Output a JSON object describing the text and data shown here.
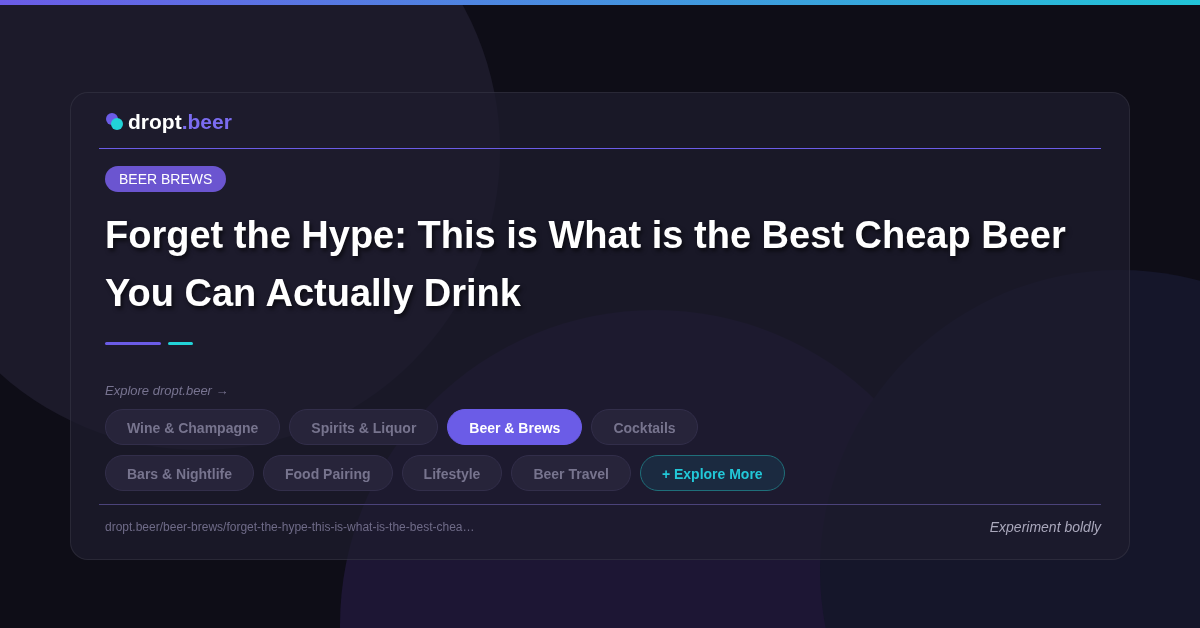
{
  "brand": {
    "name": "dropt",
    "suffix": ".beer"
  },
  "category_badge": "BEER BREWS",
  "headline": "Forget the Hype: This is What is the Best Cheap Beer You Can Actually Drink",
  "explore_label": "Explore dropt.beer →",
  "categories": [
    {
      "label": "Wine & Champagne",
      "kind": "category",
      "selected": false
    },
    {
      "label": "Spirits & Liquor",
      "kind": "category",
      "selected": false
    },
    {
      "label": "Beer & Brews",
      "kind": "category",
      "selected": true
    },
    {
      "label": "Cocktails",
      "kind": "category",
      "selected": false
    },
    {
      "label": "Bars & Nightlife",
      "kind": "category",
      "selected": false
    },
    {
      "label": "Food Pairing",
      "kind": "category",
      "selected": false
    },
    {
      "label": "Lifestyle",
      "kind": "category",
      "selected": false
    },
    {
      "label": "Beer Travel",
      "kind": "category",
      "selected": false
    },
    {
      "label": "+ Explore More",
      "kind": "more",
      "selected": false
    }
  ],
  "footer": {
    "url": "dropt.beer/beer-brews/forget-the-hype-this-is-what-is-the-best-chea…",
    "tagline": "Experiment boldly"
  }
}
